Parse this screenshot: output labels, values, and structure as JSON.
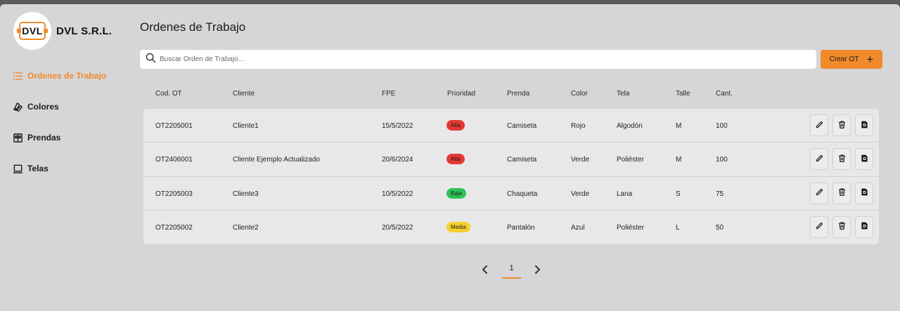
{
  "brand": {
    "logo_text": "DVL",
    "name": "DVL S.R.L."
  },
  "nav": {
    "items": [
      {
        "label": "Ordenes de Trabajo",
        "icon": "list-icon",
        "active": true
      },
      {
        "label": "Colores",
        "icon": "palette-icon",
        "active": false
      },
      {
        "label": "Prendas",
        "icon": "clothing-icon",
        "active": false
      },
      {
        "label": "Telas",
        "icon": "fabric-icon",
        "active": false
      }
    ]
  },
  "page": {
    "title": "Ordenes de Trabajo"
  },
  "search": {
    "placeholder": "Buscar Orden de Trabajo..."
  },
  "create_button": {
    "label": "Crear OT",
    "icon": "plus-icon"
  },
  "table": {
    "headers": [
      "Cod. OT",
      "Cliente",
      "FPE",
      "Prioridad",
      "Prenda",
      "Color",
      "Tela",
      "Talle",
      "Cant."
    ],
    "rows": [
      {
        "code": "OT2205001",
        "client": "Cliente1",
        "fpe": "15/5/2022",
        "priority": "Alta",
        "priority_color": "#e53935",
        "garment": "Camiseta",
        "color": "Rojo",
        "fabric": "Algodón",
        "size": "M",
        "qty": "100"
      },
      {
        "code": "OT2406001",
        "client": "Cliente Ejemplo Actualizado",
        "fpe": "20/6/2024",
        "priority": "Alta",
        "priority_color": "#e53935",
        "garment": "Camiseta",
        "color": "Verde",
        "fabric": "Poliéster",
        "size": "M",
        "qty": "100"
      },
      {
        "code": "OT2205003",
        "client": "Cliente3",
        "fpe": "10/5/2022",
        "priority": "Baja",
        "priority_color": "#2ec35a",
        "garment": "Chaqueta",
        "color": "Verde",
        "fabric": "Lana",
        "size": "S",
        "qty": "75"
      },
      {
        "code": "OT2205002",
        "client": "Cliente2",
        "fpe": "20/5/2022",
        "priority": "Media",
        "priority_color": "#f7cf2f",
        "garment": "Pantalón",
        "color": "Azul",
        "fabric": "Poliéster",
        "size": "L",
        "qty": "50"
      }
    ],
    "row_actions": [
      "edit-icon",
      "trash-icon",
      "document-icon"
    ]
  },
  "pagination": {
    "current_page": "1"
  },
  "colors": {
    "accent": "#f08a2a",
    "background": "#d6d6d8",
    "table_bg": "#e8e8e9"
  }
}
